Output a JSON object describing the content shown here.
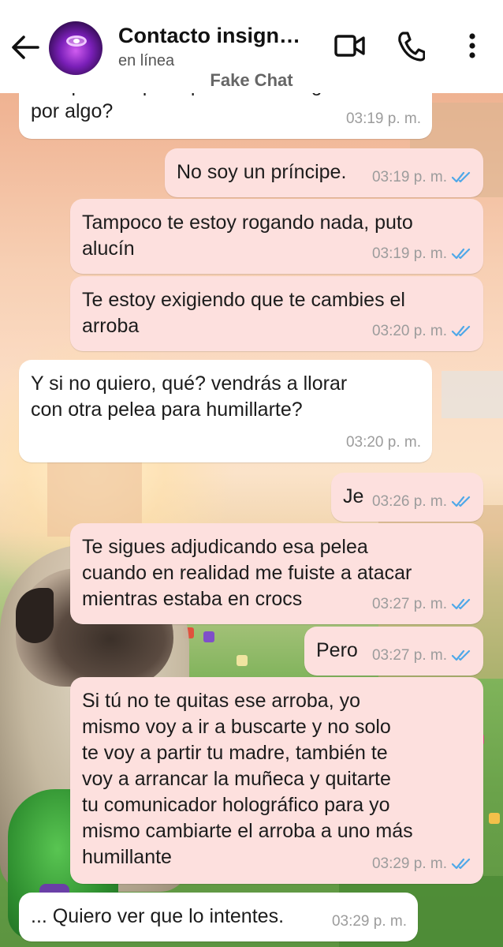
{
  "header": {
    "contact_name": "Contacto insign…",
    "status": "en línea",
    "watermark": "Fake Chat"
  },
  "icons": {
    "back": "arrow-left-icon",
    "video": "video-camera-icon",
    "phone": "phone-icon",
    "menu": "more-vertical-icon",
    "read_receipt": "double-check-icon"
  },
  "colors": {
    "incoming_bubble": "#ffffff",
    "outgoing_bubble": "#fde0de",
    "read_tick": "#4fa8e8",
    "timestamp": "#9c9c9c"
  },
  "messages": [
    {
      "direction": "in",
      "text": "Así que... El príncipe me está rogando\npor algo?",
      "time": "03:19 p. m."
    },
    {
      "direction": "out",
      "text": "No soy un príncipe.",
      "time": "03:19 p. m."
    },
    {
      "direction": "out",
      "text": "Tampoco te estoy rogando nada, puto\nalucín",
      "time": "03:19 p. m."
    },
    {
      "direction": "out",
      "text": "Te estoy exigiendo que te cambies el\narroba",
      "time": "03:20 p. m."
    },
    {
      "direction": "in",
      "text": "Y si no quiero, qué? vendrás a llorar\ncon otra pelea para humillarte?",
      "time": "03:20 p. m."
    },
    {
      "direction": "out",
      "text": "Je",
      "time": "03:26 p. m."
    },
    {
      "direction": "out",
      "text": "Te sigues adjudicando esa pelea\ncuando en realidad me fuiste a atacar\nmientras estaba en crocs",
      "time": "03:27 p. m."
    },
    {
      "direction": "out",
      "text": "Pero",
      "time": "03:27 p. m."
    },
    {
      "direction": "out",
      "text": "Si tú no te quitas ese arroba, yo\nmismo voy a ir a buscarte y no solo\nte voy a partir tu madre, también te\nvoy a arrancar la muñeca y quitarte\ntu comunicador holográfico para yo\nmismo cambiarte el arroba a uno más\nhumillante",
      "time": "03:29 p. m."
    },
    {
      "direction": "in",
      "text": "... Quiero ver que lo intentes.",
      "time": "03:29 p. m."
    }
  ]
}
